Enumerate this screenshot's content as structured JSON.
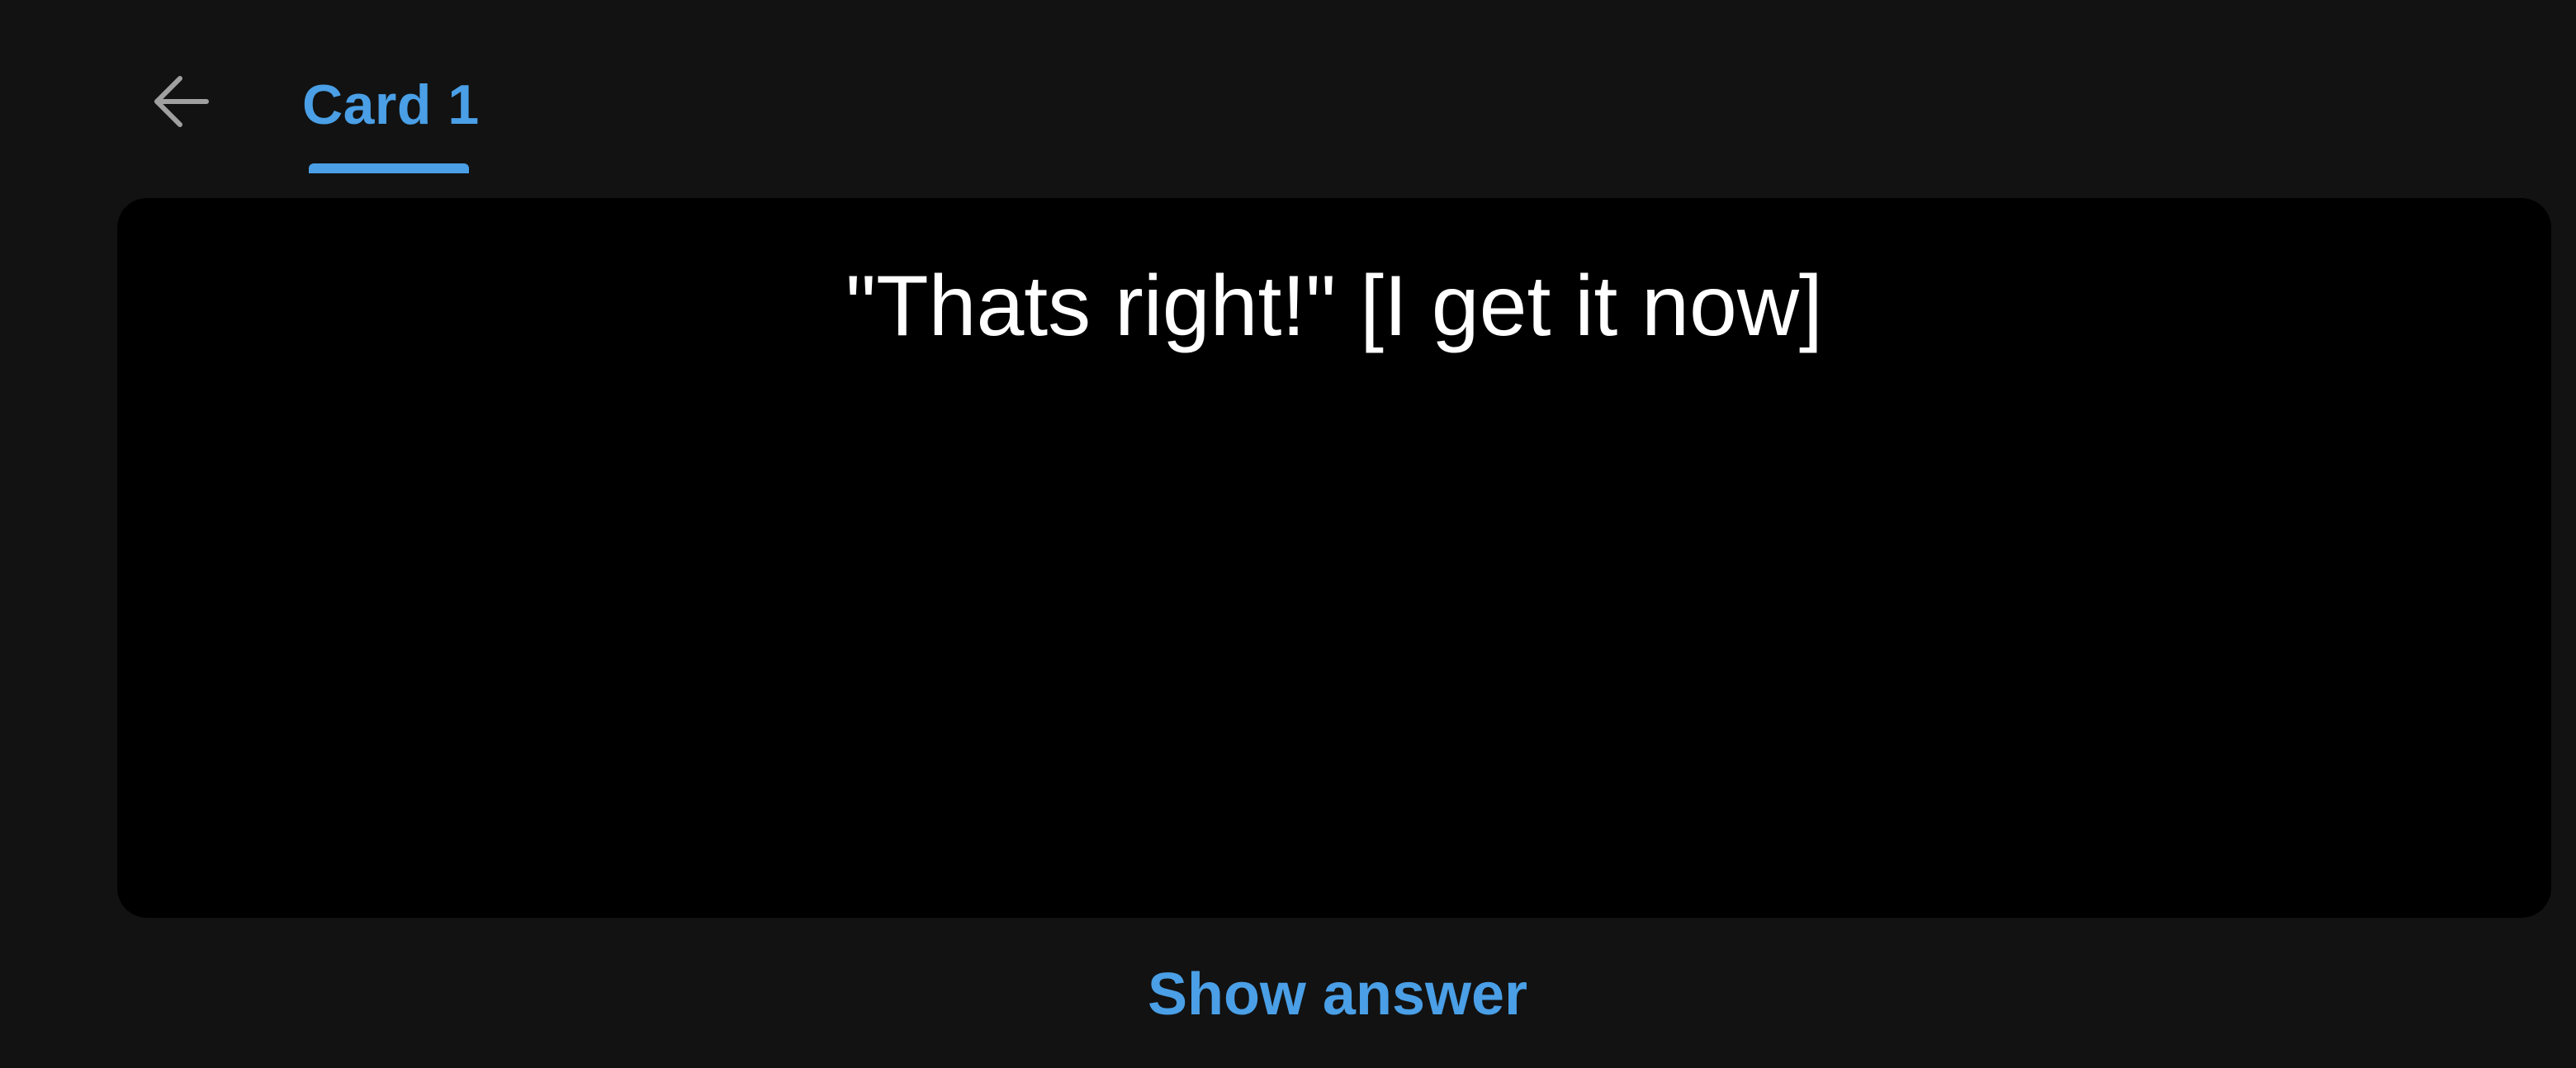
{
  "header": {
    "back_icon": "arrow-left-icon",
    "tab_label": "Card 1"
  },
  "card": {
    "question": "\"Thats right!\" [I get it now]"
  },
  "footer": {
    "show_answer_label": "Show answer"
  },
  "colors": {
    "background": "#121212",
    "card_background": "#000000",
    "accent": "#4a9fe6",
    "text": "#ffffff",
    "icon": "#a0a0a0"
  }
}
